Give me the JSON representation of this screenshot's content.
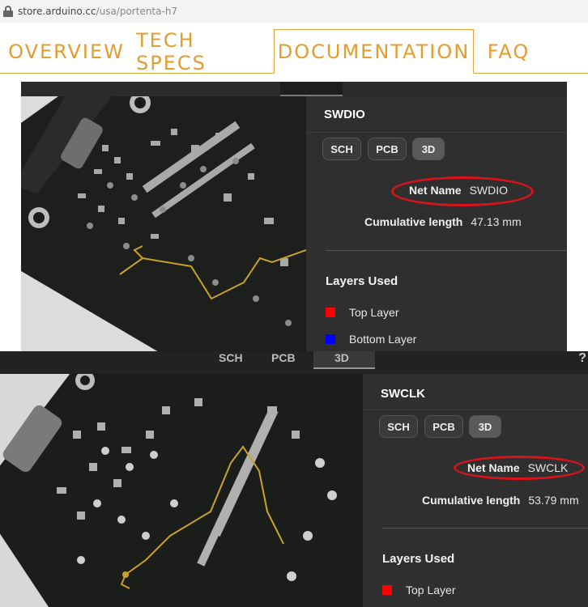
{
  "browser": {
    "url_host": "store.arduino.cc",
    "url_path": "/usa/portenta-h7"
  },
  "tabs": [
    {
      "label": "OVERVIEW",
      "active": false
    },
    {
      "label": "TECH SPECS",
      "active": false
    },
    {
      "label": "DOCUMENTATION",
      "active": true
    },
    {
      "label": "FAQ",
      "active": false
    }
  ],
  "colors": {
    "accent": "#e39c2e",
    "highlight": "#d9131b",
    "trace": "#c9a227",
    "top_layer": "#ff0000",
    "bottom_layer": "#0000ff"
  },
  "panel1": {
    "title": "SWDIO",
    "view_buttons": [
      "SCH",
      "PCB",
      "3D"
    ],
    "active_view": "3D",
    "net_name_label": "Net Name",
    "net_name_value": "SWDIO",
    "length_label": "Cumulative length",
    "length_value": "47.13 mm",
    "layers_title": "Layers Used",
    "layers": [
      {
        "name": "Top Layer",
        "color": "#ff0000"
      },
      {
        "name": "Bottom Layer",
        "color": "#0000ff"
      }
    ]
  },
  "panel2": {
    "ghost_buttons": [
      "SCH",
      "PCB",
      "3D"
    ],
    "help": "?",
    "title": "SWCLK",
    "view_buttons": [
      "SCH",
      "PCB",
      "3D"
    ],
    "active_view": "3D",
    "net_name_label": "Net Name",
    "net_name_value": "SWCLK",
    "length_label": "Cumulative length",
    "length_value": "53.79 mm",
    "layers_title": "Layers Used",
    "layers": [
      {
        "name": "Top Layer",
        "color": "#ff0000"
      }
    ]
  },
  "icons": [
    "lock-icon",
    "help-icon"
  ]
}
